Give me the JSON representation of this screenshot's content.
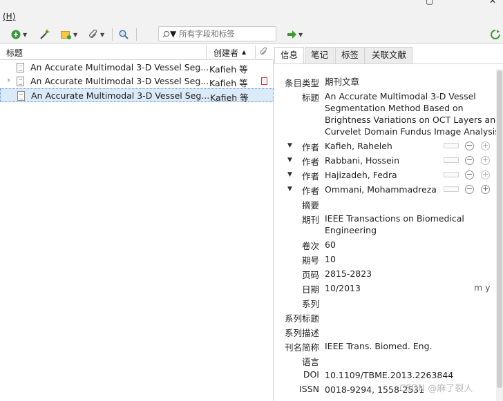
{
  "menu": {
    "help": "(H)"
  },
  "window": {
    "close_glyph": "✕",
    "restore_glyph": "▢"
  },
  "toolbar": {
    "search_placeholder": "所有字段和标签",
    "new_item_icon": "plus-circle-icon",
    "magic_wand_icon": "magic-wand-icon",
    "new_note_icon": "note-icon",
    "attachment_icon": "paperclip-icon",
    "lookup_icon": "magnifier-icon",
    "go_icon": "green-arrow-icon",
    "sync_icon": "sync-icon"
  },
  "columns": {
    "title": "标题",
    "creator": "创建者"
  },
  "items": [
    {
      "title": "An Accurate Multimodal 3-D Vessel Seg...",
      "creator": "Kafieh 等",
      "selected": false,
      "has_twisty": false,
      "has_pdf": false
    },
    {
      "title": "An Accurate Multimodal 3-D Vessel Seg...",
      "creator": "Kafieh 等",
      "selected": false,
      "has_twisty": true,
      "has_pdf": true
    },
    {
      "title": "An Accurate Multimodal 3-D Vessel Seg...",
      "creator": "Kafieh 等",
      "selected": true,
      "has_twisty": false,
      "has_pdf": false
    }
  ],
  "tabs": [
    "信息",
    "笔记",
    "标签",
    "关联文献"
  ],
  "info": {
    "item_type_label": "条目类型",
    "item_type": "期刊文章",
    "title_label": "标题",
    "title_lines": [
      "An Accurate Multimodal 3-D Vessel",
      "Segmentation Method Based on",
      "Brightness Variations on OCT Layers and",
      "Curvelet Domain Fundus Image Analysis"
    ],
    "author_label": "作者",
    "authors": [
      "Kafieh, Raheleh",
      "Rabbani, Hossein",
      "Hajizadeh, Fedra",
      "Ommani, Mohammadreza"
    ],
    "abstract_label": "摘要",
    "journal_label": "期刊",
    "journal_lines": [
      "IEEE Transactions on Biomedical",
      "Engineering"
    ],
    "volume_label": "卷次",
    "volume": "60",
    "issue_label": "期号",
    "issue": "10",
    "pages_label": "页码",
    "pages": "2815-2823",
    "date_label": "日期",
    "date": "10/2013",
    "date_format": "m y",
    "series_label": "系列",
    "series_title_label": "系列标题",
    "series_text_label": "系列描述",
    "journal_abbr_label": "刊名简称",
    "journal_abbr": "IEEE Trans. Biomed. Eng.",
    "language_label": "语言",
    "doi_label": "DOI",
    "doi": "10.1109/TBME.2013.2263844",
    "issn_label": "ISSN",
    "issn": "0018-9294, 1558-2531"
  },
  "watermark": "CSDN @麻了裂人"
}
